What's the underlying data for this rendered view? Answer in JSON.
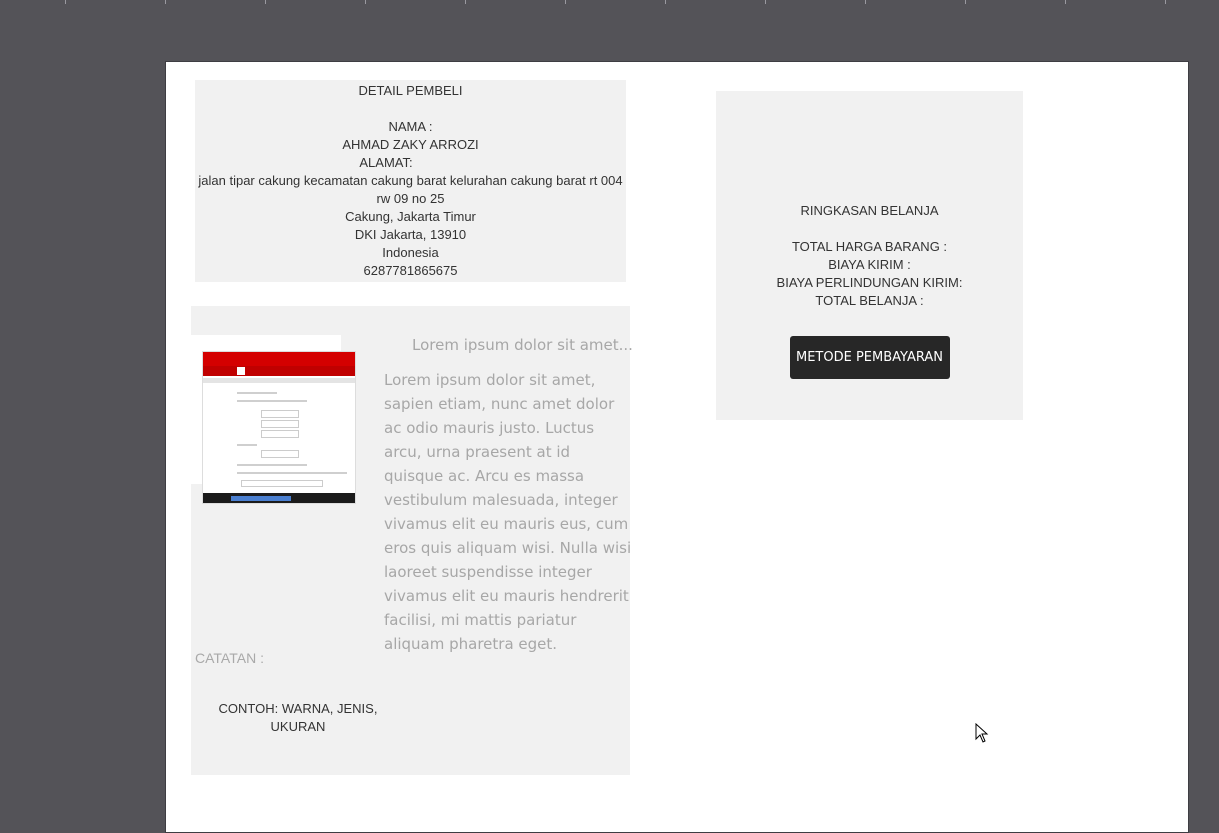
{
  "buyer": {
    "heading": "DETAIL PEMBELI",
    "name_label": "NAMA :",
    "name": "AHMAD ZAKY ARROZI",
    "address_label": "ALAMAT:",
    "street": "jalan tipar cakung kecamatan cakung barat kelurahan cakung barat rt 004 rw 09 no 25",
    "city": "Cakung, Jakarta Timur",
    "province": "DKI Jakarta, 13910",
    "country": "Indonesia",
    "phone": "6287781865675"
  },
  "product": {
    "title": "Lorem ipsum dolor sit amet...",
    "description": "Lorem ipsum dolor sit amet, sapien etiam, nunc amet dolor ac odio mauris justo. Luctus arcu, urna praesent at id quisque ac. Arcu es massa vestibulum malesuada, integer vivamus elit eu mauris eus, cum eros quis aliquam wisi. Nulla wisi laoreet suspendisse integer vivamus elit eu mauris hendrerit facilisi, mi mattis pariatur aliquam pharetra eget.",
    "note_label": "CATATAN :",
    "note_example": "CONTOH: WARNA, JENIS, UKURAN",
    "thumbnail_icon": "product-screenshot-thumbnail"
  },
  "summary": {
    "heading": "RINGKASAN BELANJA",
    "total_items_label": "TOTAL HARGA BARANG :",
    "shipping_label": "BIAYA KIRIM :",
    "protection_label": "BIAYA PERLINDUNGAN KIRIM:",
    "grand_total_label": "TOTAL BELANJA :",
    "pay_button": "METODE PEMBAYARAN"
  },
  "colors": {
    "workspace": "#545358",
    "panel": "#f1f1f1",
    "button": "#272727",
    "muted_text": "#a7a7a7"
  }
}
